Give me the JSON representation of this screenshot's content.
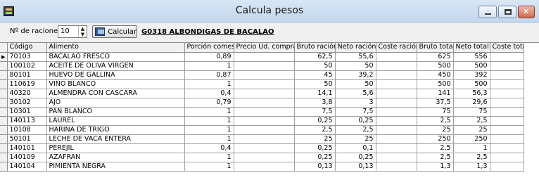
{
  "window": {
    "title": "Calcula pesos"
  },
  "toolbar": {
    "raciones_label": "Nº de raciones",
    "raciones_value": "10",
    "calc_label": "Calcular",
    "recipe_name": "G0318 ALBONDIGAS DE BACALAO"
  },
  "grid": {
    "columns": [
      "Código",
      "Alimento",
      "Porción comest",
      "Precio Ud. compra",
      "Bruto ración",
      "Neto ración",
      "Coste ración",
      "Bruto total",
      "Neto total",
      "Coste total"
    ],
    "rows": [
      [
        "70103",
        "BACALAO FRESCO",
        "0,89",
        "",
        "62,5",
        "55,6",
        "",
        "625",
        "556",
        ""
      ],
      [
        "100102",
        "ACEITE DE OLIVA VIRGEN",
        "1",
        "",
        "50",
        "50",
        "",
        "500",
        "500",
        ""
      ],
      [
        "80101",
        "HUEVO DE GALLINA",
        "0,87",
        "",
        "45",
        "39,2",
        "",
        "450",
        "392",
        ""
      ],
      [
        "110619",
        "VINO BLANCO",
        "1",
        "",
        "50",
        "50",
        "",
        "500",
        "500",
        ""
      ],
      [
        "40320",
        "ALMENDRA CON CASCARA",
        "0,4",
        "",
        "14,1",
        "5,6",
        "",
        "141",
        "56,3",
        ""
      ],
      [
        "30102",
        "AJO",
        "0,79",
        "",
        "3,8",
        "3",
        "",
        "37,5",
        "29,6",
        ""
      ],
      [
        "10301",
        "PAN BLANCO",
        "1",
        "",
        "7,5",
        "7,5",
        "",
        "75",
        "75",
        ""
      ],
      [
        "140113",
        "LAUREL",
        "1",
        "",
        "0,25",
        "0,25",
        "",
        "2,5",
        "2,5",
        ""
      ],
      [
        "10108",
        "HARINA DE TRIGO",
        "1",
        "",
        "2,5",
        "2,5",
        "",
        "25",
        "25",
        ""
      ],
      [
        "50101",
        "LECHE DE VACA ENTERA",
        "1",
        "",
        "25",
        "25",
        "",
        "250",
        "250",
        ""
      ],
      [
        "140101",
        "PEREJIL",
        "0,4",
        "",
        "0,25",
        "0,1",
        "",
        "2,5",
        "1",
        ""
      ],
      [
        "140109",
        "AZAFRAN",
        "1",
        "",
        "0,25",
        "0,25",
        "",
        "2,5",
        "2,5",
        ""
      ],
      [
        "140104",
        "PIMIENTA NEGRA",
        "1",
        "",
        "0,13",
        "0,13",
        "",
        "1,3",
        "1,3",
        ""
      ]
    ]
  }
}
